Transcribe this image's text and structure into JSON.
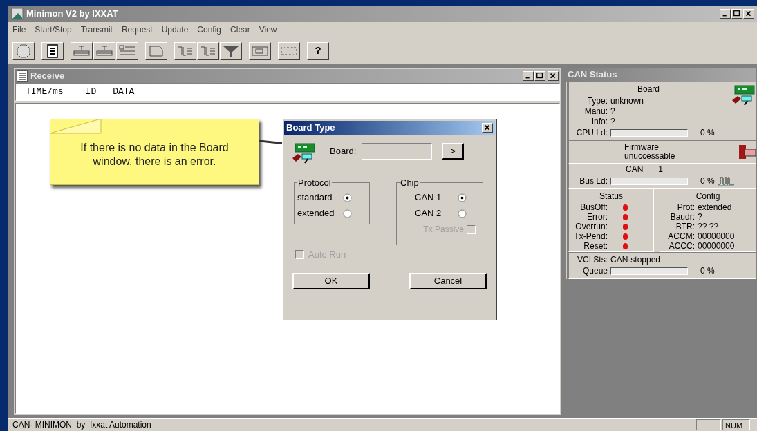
{
  "window": {
    "title": "Minimon V2 by IXXAT"
  },
  "menu": [
    "File",
    "Start/Stop",
    "Transmit",
    "Request",
    "Update",
    "Config",
    "Clear",
    "View"
  ],
  "toolbar": [
    {
      "kind": "stop"
    },
    {
      "kind": "list"
    },
    {
      "kind": "tx"
    },
    {
      "kind": "tx"
    },
    {
      "kind": "rows"
    },
    {
      "kind": "clear"
    },
    {
      "kind": "message"
    },
    {
      "kind": "message"
    },
    {
      "kind": "filter"
    },
    {
      "kind": "board"
    },
    {
      "kind": "blank"
    },
    {
      "kind": "help",
      "label": "?"
    }
  ],
  "receive": {
    "title": "Receive",
    "columns": [
      "TIME/ms",
      "ID",
      "DATA"
    ]
  },
  "can_status": {
    "title": "CAN Status",
    "board": {
      "heading": "Board",
      "rows": [
        {
          "label": "Type:",
          "value": "unknown"
        },
        {
          "label": "Manu:",
          "value": "?"
        },
        {
          "label": "Info:",
          "value": "?"
        }
      ],
      "cpu": {
        "label": "CPU Ld:",
        "level": 0,
        "reading": "0 %"
      }
    },
    "firmware": [
      "Firmware",
      "unuccessable"
    ],
    "can": {
      "label": "CAN",
      "number": "1",
      "bus": {
        "label": "Bus Ld:",
        "level": 0,
        "reading": "0 %"
      }
    },
    "status": {
      "heading": "Status",
      "items": [
        {
          "label": "BusOff:",
          "color": "#e01010"
        },
        {
          "label": "Error:",
          "color": "#e01010"
        },
        {
          "label": "Overrun:",
          "color": "#e01010"
        },
        {
          "label": "Tx-Pend:",
          "color": "#e01010"
        },
        {
          "label": "Reset:",
          "color": "#e01010"
        }
      ]
    },
    "config": {
      "heading": "Config",
      "rows": [
        {
          "label": "Prot:",
          "value": "extended"
        },
        {
          "label": "Baudr:",
          "value": "?"
        },
        {
          "label": "BTR:",
          "value": "?? ??"
        },
        {
          "label": "ACCM:",
          "value": "00000000"
        },
        {
          "label": "ACCC:",
          "value": "00000000"
        }
      ]
    },
    "vci": {
      "label": "VCI Sts:",
      "value": "CAN-stopped"
    },
    "queue": {
      "label": "Queue",
      "level": 0,
      "reading": "0 %"
    }
  },
  "dialog": {
    "title": "Board Type",
    "board_label": "Board:",
    "browse": ">",
    "protocol": {
      "title": "Protocol",
      "options": [
        {
          "label": "standard",
          "selected": true
        },
        {
          "label": "extended",
          "selected": false
        }
      ]
    },
    "chip": {
      "title": "Chip",
      "options": [
        {
          "label": "CAN 1",
          "selected": true
        },
        {
          "label": "CAN 2",
          "selected": false
        }
      ],
      "tx_passive": {
        "label": "Tx Passive",
        "checked": false,
        "disabled": true
      }
    },
    "auto_run": {
      "label": "Auto Run",
      "checked": false,
      "disabled": true
    },
    "buttons": [
      "OK",
      "Cancel"
    ]
  },
  "callout": "If there is no data in the Board window, there is an error.",
  "status_bar": {
    "text": "CAN- MINIMON  by  Ixxat Automation",
    "indicator": "NUM"
  }
}
